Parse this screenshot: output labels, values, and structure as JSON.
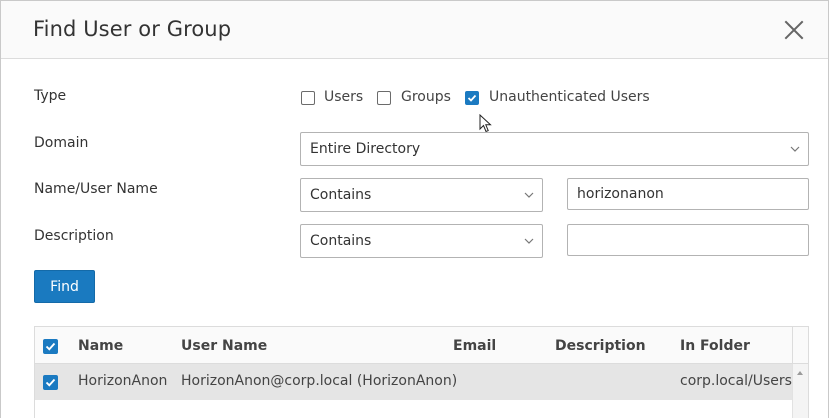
{
  "dialog": {
    "title": "Find User or Group"
  },
  "form": {
    "type_label": "Type",
    "type_options": [
      {
        "label": "Users",
        "checked": false
      },
      {
        "label": "Groups",
        "checked": false
      },
      {
        "label": "Unauthenticated Users",
        "checked": true
      }
    ],
    "domain_label": "Domain",
    "domain_value": "Entire Directory",
    "name_label": "Name/User Name",
    "name_operator": "Contains",
    "name_value": "horizonanon",
    "description_label": "Description",
    "description_operator": "Contains",
    "description_value": "",
    "find_label": "Find"
  },
  "results": {
    "columns": [
      "Name",
      "User Name",
      "Email",
      "Description",
      "In Folder"
    ],
    "rows": [
      {
        "checked": true,
        "name": "HorizonAnon",
        "user_name": "HorizonAnon@corp.local (HorizonAnon)",
        "email": "",
        "description": "",
        "folder": "corp.local/Users"
      }
    ]
  },
  "colors": {
    "accent": "#1b7ac1",
    "button": "#1a7ac0",
    "row_selected": "#e5e5e5"
  },
  "icons": {
    "close": "close-icon",
    "checkbox_check": "check-icon",
    "dropdown": "chevron-down-icon",
    "cursor": "mouse-pointer-icon",
    "scroll_up": "scroll-up-arrow-icon"
  }
}
